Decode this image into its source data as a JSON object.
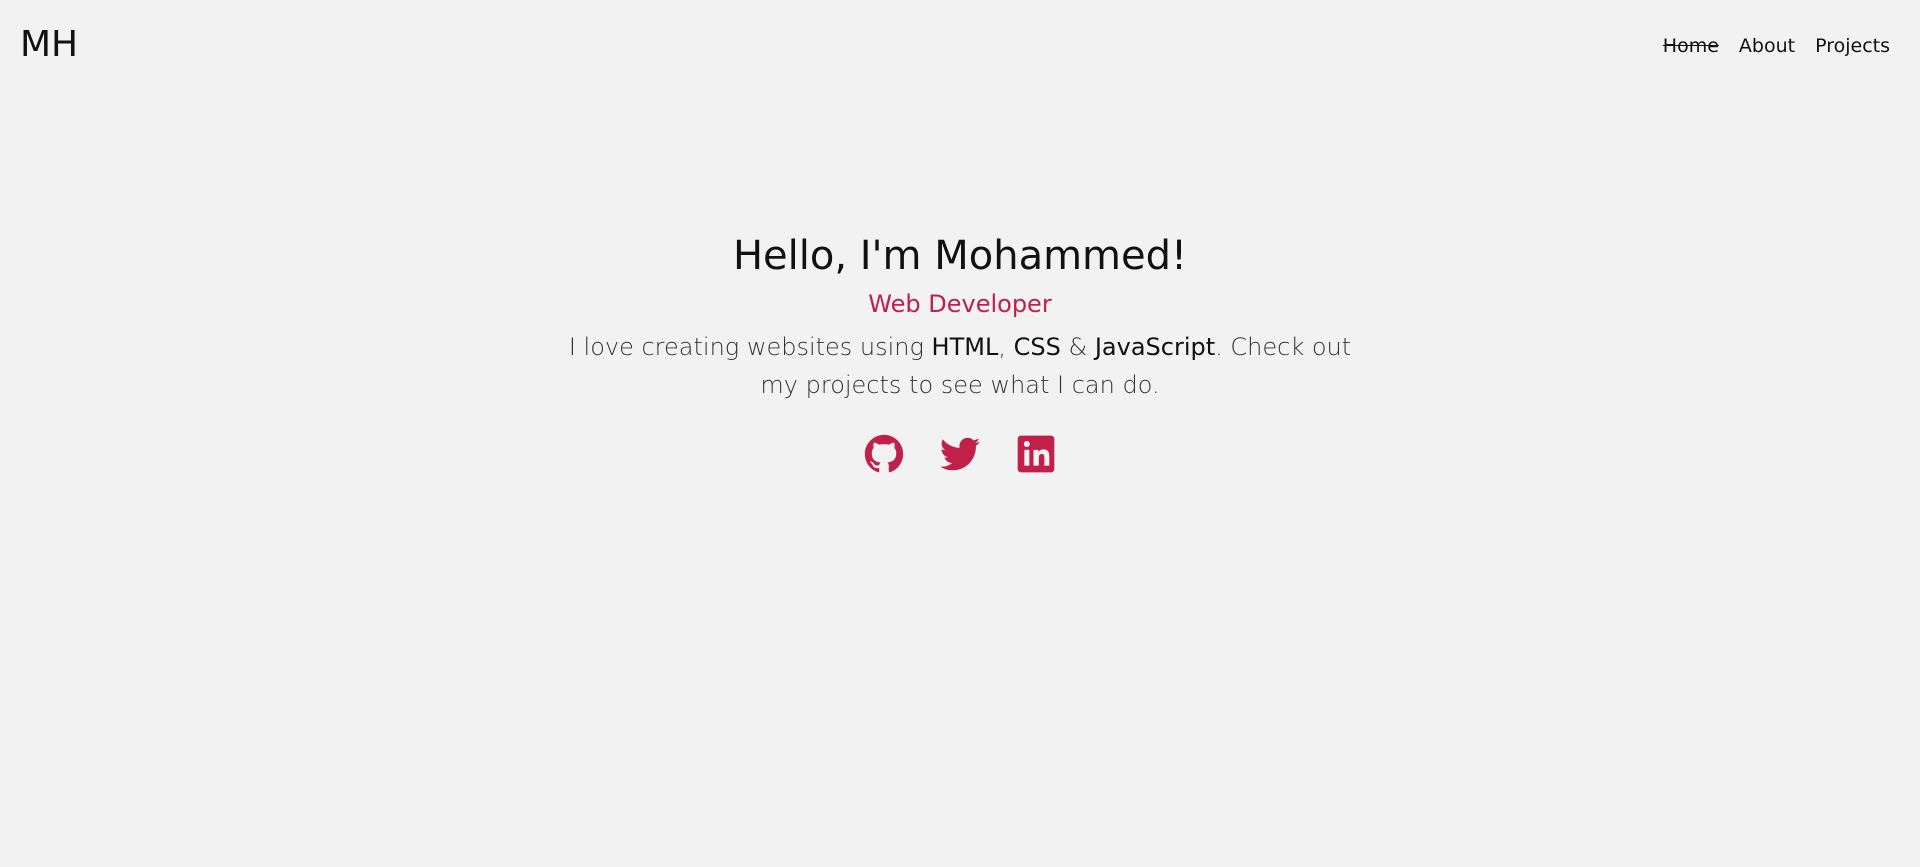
{
  "header": {
    "logo": "MH",
    "nav": [
      {
        "label": "Home",
        "active": true
      },
      {
        "label": "About",
        "active": false
      },
      {
        "label": "Projects",
        "active": false
      }
    ]
  },
  "hero": {
    "title": "Hello, I'm Mohammed!",
    "subtitle": "Web Developer",
    "desc_parts": {
      "p1": "I love creating websites using ",
      "html": "HTML",
      "comma": ", ",
      "css": "CSS",
      "amp": " & ",
      "js": "JavaScript",
      "p2": ". Check out my projects to see what I can do."
    }
  },
  "social": {
    "icons": [
      "github-icon",
      "twitter-icon",
      "linkedin-icon"
    ]
  },
  "colors": {
    "accent": "#c0204a",
    "background": "#f2f2f2",
    "text": "#111111"
  }
}
